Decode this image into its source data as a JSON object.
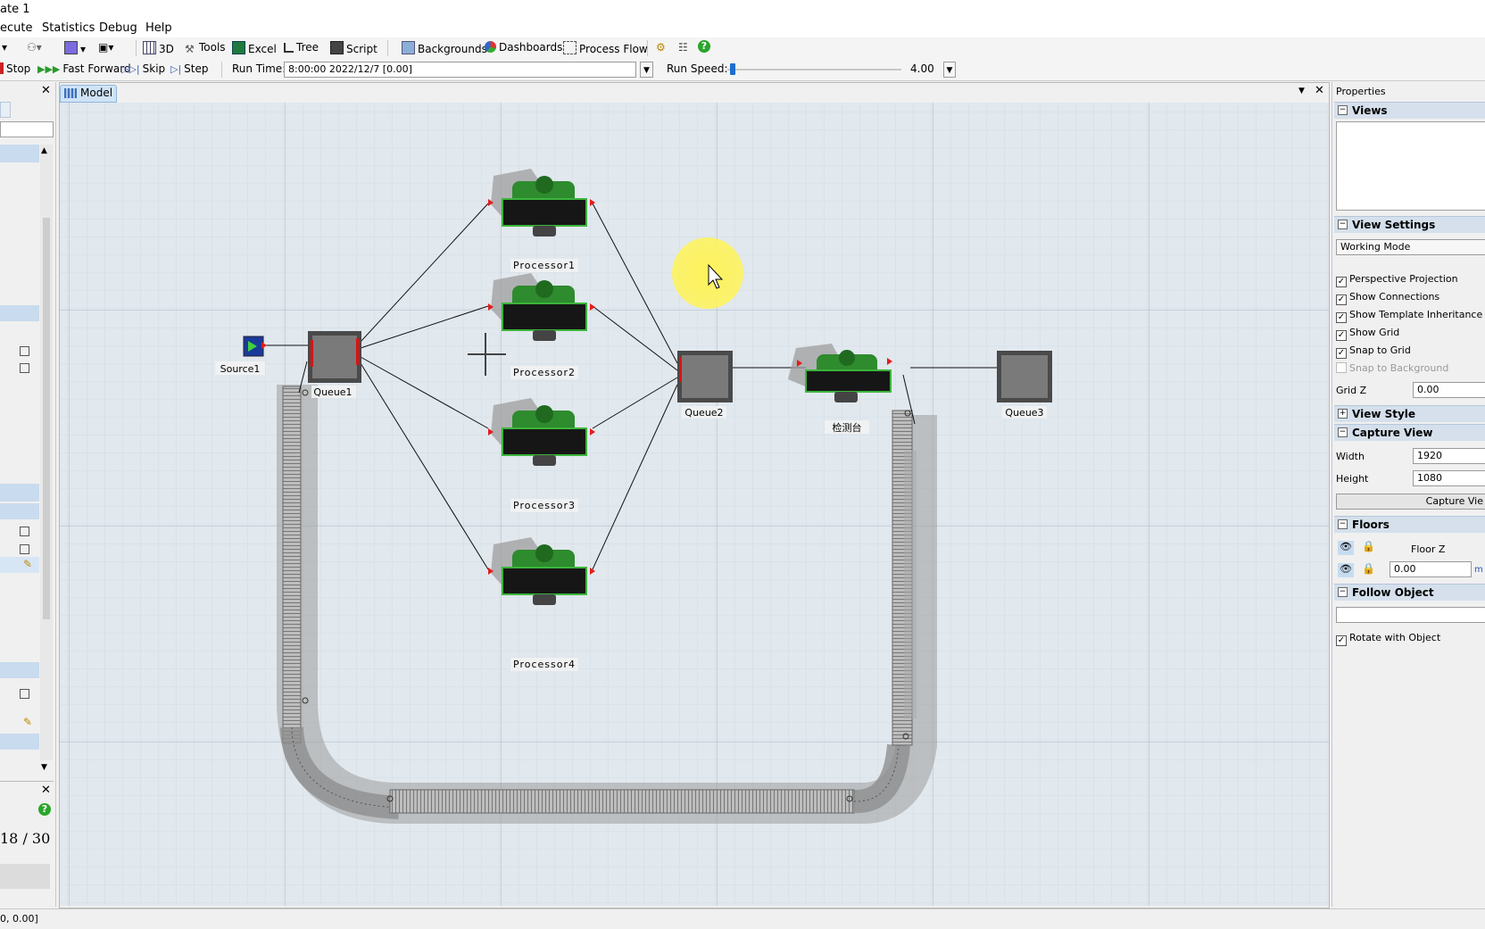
{
  "window": {
    "title": "ate 1"
  },
  "menu": {
    "items": [
      "ecute",
      "Statistics",
      "Debug",
      "Help"
    ]
  },
  "toolbar": {
    "three_d": "3D",
    "tools": "Tools",
    "excel": "Excel",
    "tree": "Tree",
    "script": "Script",
    "backgrounds": "Backgrounds",
    "dashboards": "Dashboards",
    "process_flow": "Process Flow"
  },
  "run_controls": {
    "stop": "Stop",
    "fast_forward": "Fast Forward",
    "skip": "Skip",
    "step": "Step",
    "run_time_label": "Run Time:",
    "run_time_value": "8:00:00  2022/12/7  [0.00]",
    "run_speed_label": "Run Speed:",
    "run_speed_value": "4.00",
    "run_speed_fraction": 0.03
  },
  "left_panel": {
    "counter": "18 / 30"
  },
  "model_tab": {
    "label": "Model"
  },
  "objects": {
    "source1": "Source1",
    "queue1": "Queue1",
    "processor1": "Processor1",
    "processor2": "Processor2",
    "processor3": "Processor3",
    "processor4": "Processor4",
    "queue2": "Queue2",
    "inspection": "检测台",
    "queue3": "Queue3"
  },
  "properties": {
    "title": "Properties",
    "views": "Views",
    "view_settings": "View Settings",
    "working_mode": "Working Mode",
    "checkboxes": [
      {
        "label": "Perspective Projection",
        "checked": true
      },
      {
        "label": "Show Connections",
        "checked": true
      },
      {
        "label": "Show Template Inheritance (T)",
        "checked": true
      },
      {
        "label": "Show Grid",
        "checked": true
      },
      {
        "label": "Snap to Grid",
        "checked": true
      },
      {
        "label": "Snap to Background",
        "checked": false
      }
    ],
    "grid_z_label": "Grid Z",
    "grid_z_value": "0.00",
    "view_style": "View Style",
    "capture_view": "Capture View",
    "width_label": "Width",
    "width_value": "1920",
    "height_label": "Height",
    "height_value": "1080",
    "capture_button": "Capture Vie",
    "floors": "Floors",
    "floor_z": "Floor Z",
    "floor_value": "0.00",
    "floor_unit": "m",
    "follow_object": "Follow Object",
    "rotate_with_object": "Rotate with Object"
  },
  "status": {
    "coords": "0, 0.00]"
  }
}
